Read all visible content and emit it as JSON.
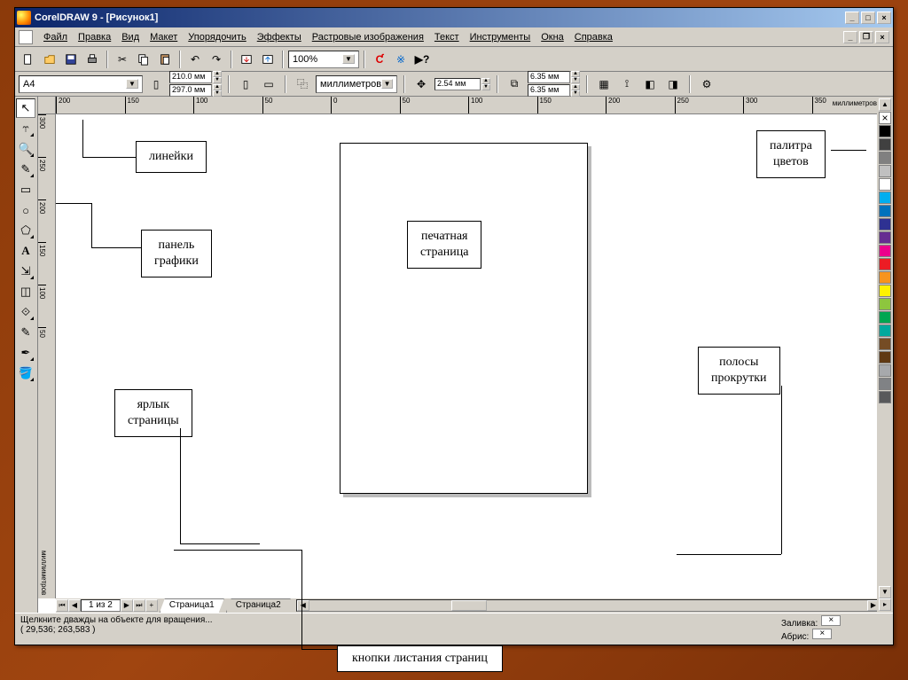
{
  "title": "CorelDRAW 9 - [Рисунок1]",
  "menu": [
    "Файл",
    "Правка",
    "Вид",
    "Макет",
    "Упорядочить",
    "Эффекты",
    "Растровые изображения",
    "Текст",
    "Инструменты",
    "Окна",
    "Справка"
  ],
  "toolbar1": {
    "zoom": "100%"
  },
  "propbar": {
    "paper": "A4",
    "width": "210.0 мм",
    "height": "297.0 мм",
    "units": "миллиметров",
    "nudge": "2.54 мм",
    "dup_x": "6.35 мм",
    "dup_y": "6.35 мм"
  },
  "ruler_h_ticks": [
    "200",
    "150",
    "100",
    "50",
    "0",
    "50",
    "100",
    "150",
    "200",
    "250",
    "300",
    "350"
  ],
  "ruler_h_unit": "миллиметров",
  "ruler_v_ticks": [
    "300",
    "250",
    "200",
    "150",
    "100",
    "50"
  ],
  "ruler_v_unit": "миллиметров",
  "pagenav": {
    "label": "1 из 2",
    "tabs": [
      "Страница1",
      "Страница2"
    ]
  },
  "status": {
    "hint": "Щелкните дважды на объекте для вращения...",
    "coords": "( 29,536; 263,583 )",
    "fill_label": "Заливка:",
    "outline_label": "Абрис:"
  },
  "palette_colors": [
    "#000000",
    "#ffffff",
    "#00aeef",
    "#ed1c24",
    "#fff200",
    "#ec008c",
    "#00a651",
    "#2e3192",
    "#8dc63e",
    "#f7941d",
    "#92278f",
    "#00a99d",
    "#a7a9ac",
    "#808285",
    "#58595b"
  ],
  "annotations": {
    "rulers": "линейки",
    "toolbox": "панель\nграфики",
    "pagetab": "ярлык\nстраницы",
    "page": "печатная\nстраница",
    "palette": "палитра\nцветов",
    "scroll": "полосы\nпрокрутки",
    "pagebuttons": "кнопки листания страниц"
  }
}
